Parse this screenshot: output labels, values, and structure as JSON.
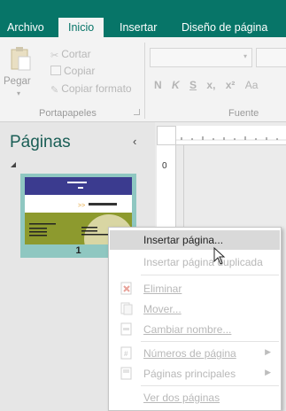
{
  "ribbon_tabs": [
    {
      "label": "Archivo",
      "active": false
    },
    {
      "label": "Inicio",
      "active": true
    },
    {
      "label": "Insertar",
      "active": false
    },
    {
      "label": "Diseño de página",
      "active": false
    }
  ],
  "clipboard": {
    "paste_label": "Pegar",
    "cut_label": "Cortar",
    "copy_label": "Copiar",
    "format_painter_label": "Copiar formato",
    "group_label": "Portapapeles"
  },
  "font_group": {
    "group_label": "Fuente",
    "format_buttons": [
      "N",
      "K",
      "S",
      "x,",
      "x²",
      "Aa"
    ]
  },
  "pages_pane": {
    "title": "Páginas",
    "collapse_glyph": "‹",
    "page_number": "1"
  },
  "ruler": {
    "vertical_zero": "0"
  },
  "context_menu": {
    "items": [
      {
        "label": "Insertar página...",
        "enabled": true,
        "highlighted": true
      },
      {
        "label": "Insertar página duplicada",
        "enabled": false
      },
      {
        "label": "Eliminar",
        "enabled": false,
        "icon": "delete-page-icon"
      },
      {
        "label": "Mover...",
        "enabled": false,
        "icon": "move-page-icon"
      },
      {
        "label": "Cambiar nombre...",
        "enabled": false,
        "icon": "rename-page-icon"
      },
      {
        "label": "Números de página",
        "enabled": false,
        "icon": "page-numbers-icon",
        "submenu": true
      },
      {
        "label": "Páginas principales",
        "enabled": false,
        "icon": "master-pages-icon",
        "submenu": true
      },
      {
        "label": "Ver dos páginas",
        "enabled": false
      }
    ]
  },
  "colors": {
    "accent": "#077568",
    "thumbnail_selection": "#8fc7c1",
    "thumb_header": "#3b3b8f",
    "thumb_band": "#8d9a2e",
    "thumb_circle": "#d9d6a3"
  }
}
